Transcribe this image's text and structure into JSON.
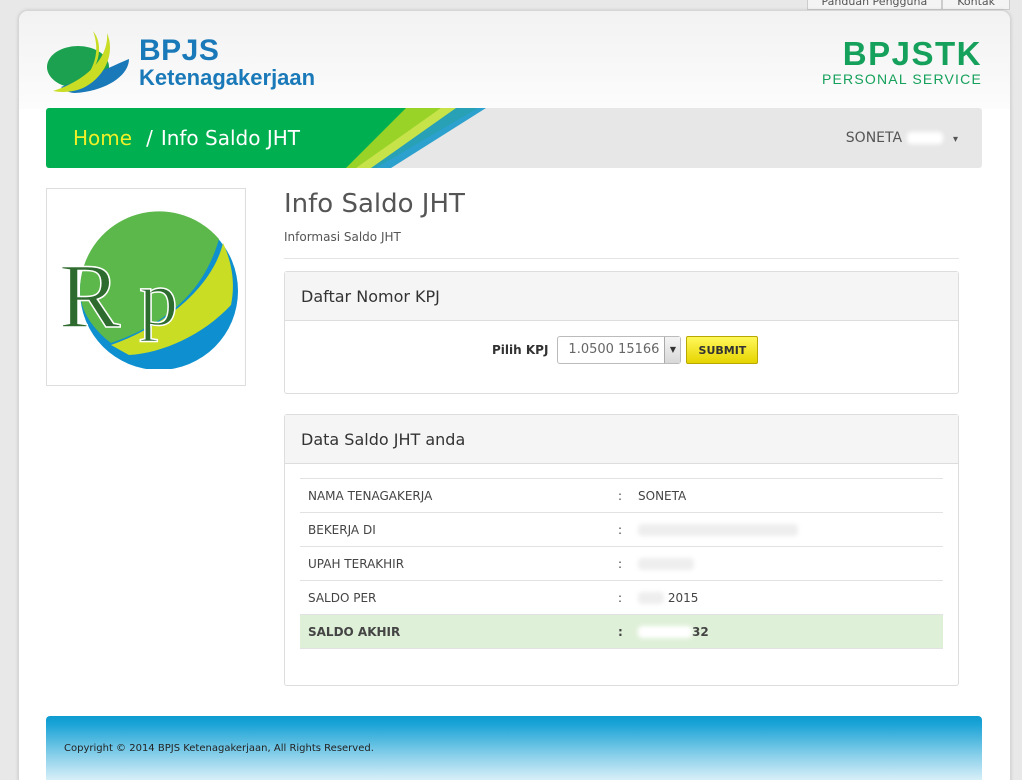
{
  "topbar": {
    "links": [
      "Panduan Pengguna",
      "Kontak"
    ]
  },
  "header": {
    "logo_title": "BPJS",
    "logo_subtitle": "Ketenagakerjaan",
    "brand_title": "BPJSTK",
    "brand_subtitle": "PERSONAL SERVICE"
  },
  "nav": {
    "breadcrumb_home": "Home",
    "breadcrumb_separator": "/",
    "breadcrumb_current": "Info Saldo JHT",
    "user_name": "SONETA",
    "caret": "▾"
  },
  "page": {
    "title": "Info Saldo JHT",
    "subtitle": "Informasi Saldo JHT"
  },
  "kpj_panel": {
    "heading": "Daftar Nomor KPJ",
    "label": "Pilih KPJ",
    "selected_value": "1.0500 15166",
    "submit_label": "SUBMIT"
  },
  "saldo_panel": {
    "heading": "Data Saldo JHT anda",
    "rows": [
      {
        "label": "NAMA TENAGAKERJA",
        "colon": ":",
        "value": "SONETA"
      },
      {
        "label": "BEKERJA DI",
        "colon": ":",
        "value": ""
      },
      {
        "label": "UPAH TERAKHIR",
        "colon": ":",
        "value": ""
      },
      {
        "label": "SALDO PER",
        "colon": ":",
        "value": "2015"
      },
      {
        "label": "SALDO AKHIR",
        "colon": ":",
        "value": "32"
      }
    ]
  },
  "footer": {
    "copyright": "Copyright © 2014 BPJS Ketenagakerjaan, All Rights Reserved."
  },
  "colors": {
    "brand_blue": "#1a79b8",
    "brand_green": "#15a15b",
    "nav_green": "#00b050",
    "breadcrumb_home": "#f0f028",
    "submit_yellow": "#f2e300",
    "highlight_row": "#dff0d8",
    "footer_blue": "#0e9bd0"
  }
}
